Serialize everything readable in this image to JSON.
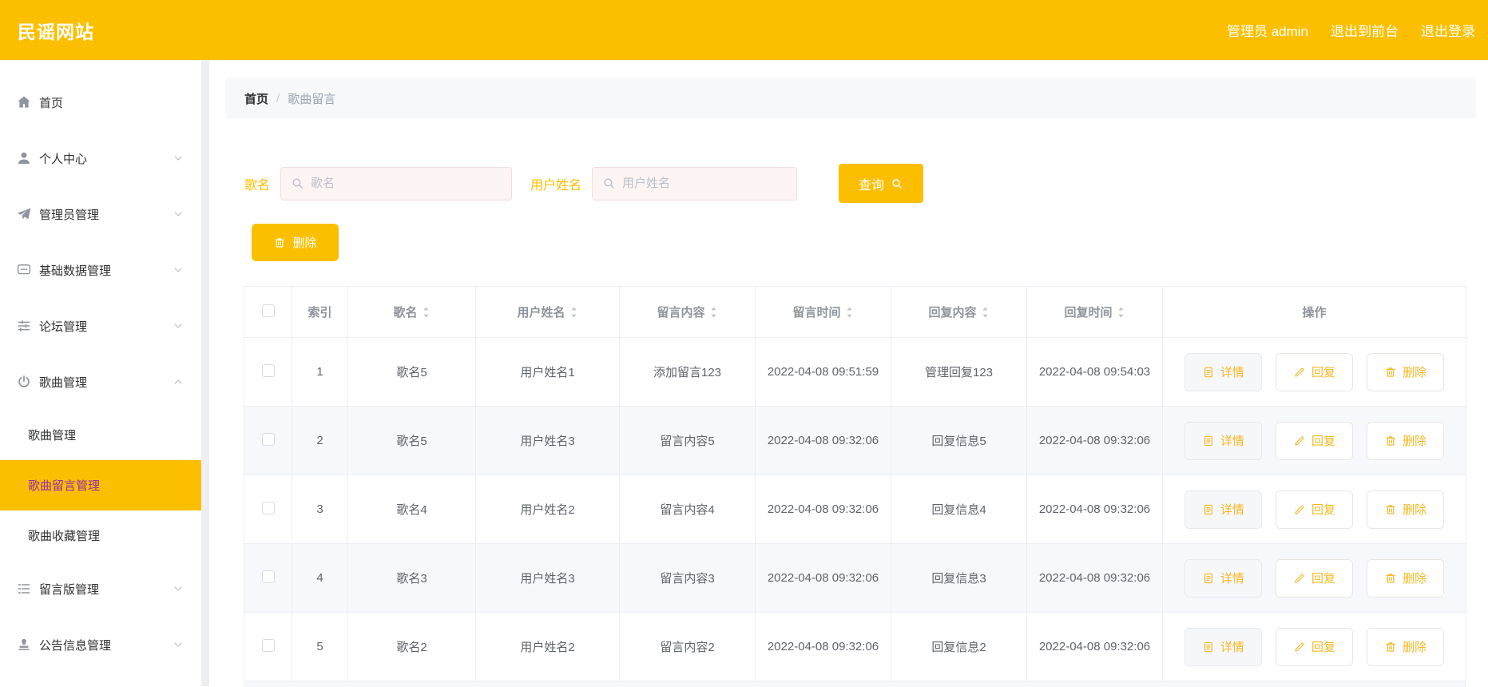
{
  "theme": {
    "accent_yellow": "#FCBF00",
    "active_purple": "#9C27B0"
  },
  "header": {
    "logo": "民谣网站",
    "admin": "管理员 admin",
    "exit_front": "退出到前台",
    "logout": "退出登录"
  },
  "sidebar": {
    "items": [
      {
        "key": "home",
        "icon": "home-icon",
        "label": "首页",
        "chevron": ""
      },
      {
        "key": "profile",
        "icon": "user-icon",
        "label": "个人中心",
        "chevron": "down"
      },
      {
        "key": "admin-manage",
        "icon": "send-icon",
        "label": "管理员管理",
        "chevron": "down"
      },
      {
        "key": "base-data",
        "icon": "message-icon",
        "label": "基础数据管理",
        "chevron": "down"
      },
      {
        "key": "forum",
        "icon": "sliders-icon",
        "label": "论坛管理",
        "chevron": "down"
      },
      {
        "key": "song",
        "icon": "power-icon",
        "label": "歌曲管理",
        "chevron": "up",
        "children": [
          {
            "key": "song-manage",
            "label": "歌曲管理",
            "active": false
          },
          {
            "key": "song-comment",
            "label": "歌曲留言管理",
            "active": true
          },
          {
            "key": "song-favorite",
            "label": "歌曲收藏管理",
            "active": false
          }
        ]
      },
      {
        "key": "message-board",
        "icon": "list-icon",
        "label": "留言版管理",
        "chevron": "down"
      },
      {
        "key": "notice",
        "icon": "stamp-icon",
        "label": "公告信息管理",
        "chevron": "down"
      }
    ]
  },
  "breadcrumb": {
    "home": "首页",
    "separator": "/",
    "current": "歌曲留言"
  },
  "filters": {
    "song_label": "歌名",
    "song_placeholder": "歌名",
    "user_label": "用户姓名",
    "user_placeholder": "用户姓名",
    "search_button": "查询",
    "delete_button": "删除"
  },
  "table": {
    "columns": [
      {
        "key": "select",
        "label": "",
        "sortable": false
      },
      {
        "key": "index",
        "label": "索引",
        "sortable": false
      },
      {
        "key": "song",
        "label": "歌名",
        "sortable": true
      },
      {
        "key": "user",
        "label": "用户姓名",
        "sortable": true
      },
      {
        "key": "content",
        "label": "留言内容",
        "sortable": true
      },
      {
        "key": "time",
        "label": "留言时间",
        "sortable": true
      },
      {
        "key": "reply",
        "label": "回复内容",
        "sortable": true
      },
      {
        "key": "reply-time",
        "label": "回复时间",
        "sortable": true
      },
      {
        "key": "ops",
        "label": "操作",
        "sortable": false
      }
    ],
    "actions": {
      "detail": "详情",
      "reply": "回复",
      "delete": "删除"
    },
    "rows": [
      {
        "index": "1",
        "song": "歌名5",
        "user": "用户姓名1",
        "content": "添加留言123",
        "time": "2022-04-08 09:51:59",
        "reply": "管理回复123",
        "reply_time": "2022-04-08 09:54:03"
      },
      {
        "index": "2",
        "song": "歌名5",
        "user": "用户姓名3",
        "content": "留言内容5",
        "time": "2022-04-08 09:32:06",
        "reply": "回复信息5",
        "reply_time": "2022-04-08 09:32:06"
      },
      {
        "index": "3",
        "song": "歌名4",
        "user": "用户姓名2",
        "content": "留言内容4",
        "time": "2022-04-08 09:32:06",
        "reply": "回复信息4",
        "reply_time": "2022-04-08 09:32:06"
      },
      {
        "index": "4",
        "song": "歌名3",
        "user": "用户姓名3",
        "content": "留言内容3",
        "time": "2022-04-08 09:32:06",
        "reply": "回复信息3",
        "reply_time": "2022-04-08 09:32:06"
      },
      {
        "index": "5",
        "song": "歌名2",
        "user": "用户姓名2",
        "content": "留言内容2",
        "time": "2022-04-08 09:32:06",
        "reply": "回复信息2",
        "reply_time": "2022-04-08 09:32:06"
      }
    ]
  }
}
